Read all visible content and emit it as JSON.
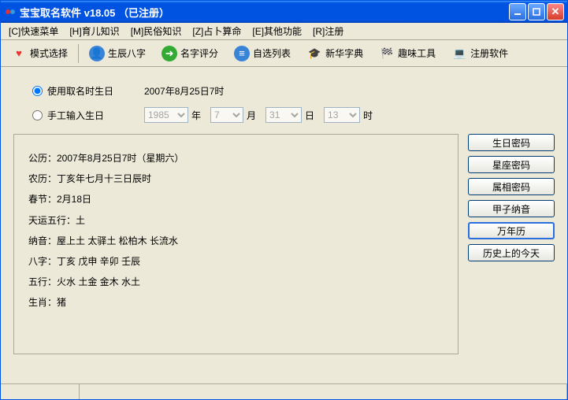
{
  "window": {
    "title": "宝宝取名软件  v18.05 （已注册）"
  },
  "menu": {
    "items": [
      "[C]快速菜单",
      "[H]育儿知识",
      "[M]民俗知识",
      "[Z]占卜算命",
      "[E]其他功能",
      "[R]注册"
    ]
  },
  "toolbar": {
    "items": [
      {
        "label": "模式选择",
        "icon": "heart"
      },
      {
        "label": "生辰八字",
        "icon": "person"
      },
      {
        "label": "名字评分",
        "icon": "arrow"
      },
      {
        "label": "自选列表",
        "icon": "list"
      },
      {
        "label": "新华字典",
        "icon": "scholar"
      },
      {
        "label": "趣味工具",
        "icon": "flag"
      },
      {
        "label": "注册软件",
        "icon": "laptop"
      }
    ]
  },
  "radios": {
    "useNaming": "使用取名时生日",
    "useNamingValue": "2007年8月25日7时",
    "manual": "手工输入生日",
    "year": "1985",
    "yearUnit": "年",
    "month": "7",
    "monthUnit": "月",
    "day": "31",
    "dayUnit": "日",
    "hour": "13",
    "hourUnit": "时"
  },
  "info": {
    "lines": [
      "公历：2007年8月25日7时（星期六）",
      "农历：丁亥年七月十三日辰时",
      "春节：2月18日",
      "天运五行：土",
      "纳音：屋上土  太驿土  松柏木  长流水",
      "八字：丁亥  戊申  辛卯  壬辰",
      "五行：火水  土金  金木  水土",
      "生肖：猪"
    ]
  },
  "sideButtons": [
    "生日密码",
    "星座密码",
    "属相密码",
    "甲子纳音",
    "万年历",
    "历史上的今天"
  ]
}
